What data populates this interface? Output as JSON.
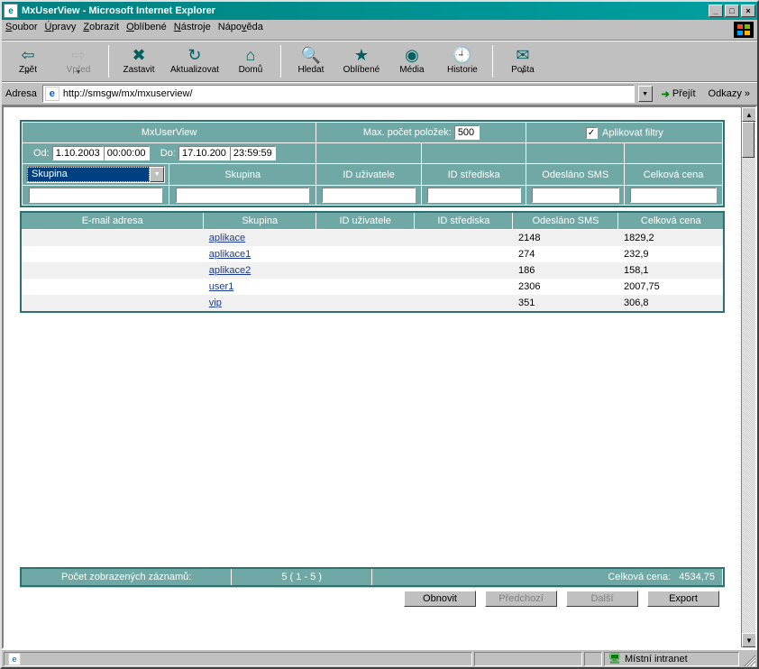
{
  "window": {
    "title": "MxUserView - Microsoft Internet Explorer"
  },
  "menu": {
    "items": [
      "Soubor",
      "Úpravy",
      "Zobrazit",
      "Oblíbené",
      "Nástroje",
      "Nápověda"
    ]
  },
  "toolbar": {
    "back": "Zpět",
    "forward": "Vpřed",
    "stop": "Zastavit",
    "refresh": "Aktualizovat",
    "home": "Domů",
    "search": "Hledat",
    "favorites": "Oblíbené",
    "media": "Média",
    "history": "Historie",
    "mail": "Pošta"
  },
  "address": {
    "label": "Adresa",
    "value": "http://smsgw/mx/mxuserview/",
    "go": "Přejít",
    "links": "Odkazy »"
  },
  "form": {
    "title": "MxUserView",
    "max_label": "Max. počet položek:",
    "max_value": "500",
    "apply_filters": "Aplikovat filtry",
    "od_label": "Od:",
    "od_date": "1.10.2003",
    "od_time": "00:00:00",
    "do_label": "Do:",
    "do_date": "17.10.200",
    "do_time": "23:59:59",
    "group_dropdown": "Skupina",
    "cols": {
      "email": "E-mail adresa",
      "skupina": "Skupina",
      "id_uz": "ID uživatele",
      "id_str": "ID střediska",
      "odeslano": "Odesláno SMS",
      "cena": "Celková cena"
    }
  },
  "rows": [
    {
      "email": "",
      "skupina": "aplikace",
      "id_uz": "",
      "id_str": "",
      "odeslano": "2148",
      "cena": "1829,2"
    },
    {
      "email": "",
      "skupina": "aplikace1",
      "id_uz": "",
      "id_str": "",
      "odeslano": "274",
      "cena": "232,9"
    },
    {
      "email": "",
      "skupina": "aplikace2",
      "id_uz": "",
      "id_str": "",
      "odeslano": "186",
      "cena": "158,1"
    },
    {
      "email": "",
      "skupina": "user1",
      "id_uz": "",
      "id_str": "",
      "odeslano": "2306",
      "cena": "2007,75"
    },
    {
      "email": "",
      "skupina": "vip",
      "id_uz": "",
      "id_str": "",
      "odeslano": "351",
      "cena": "306,8"
    }
  ],
  "footer": {
    "count_label": "Počet zobrazených záznamů:",
    "count_value": "5 ( 1 - 5 )",
    "total_label": "Celková cena:",
    "total_value": "4534,75"
  },
  "buttons": {
    "obnovit": "Obnovit",
    "predchozi": "Předchozí",
    "dalsi": "Další",
    "export": "Export"
  },
  "status": {
    "zone": "Místní intranet"
  }
}
